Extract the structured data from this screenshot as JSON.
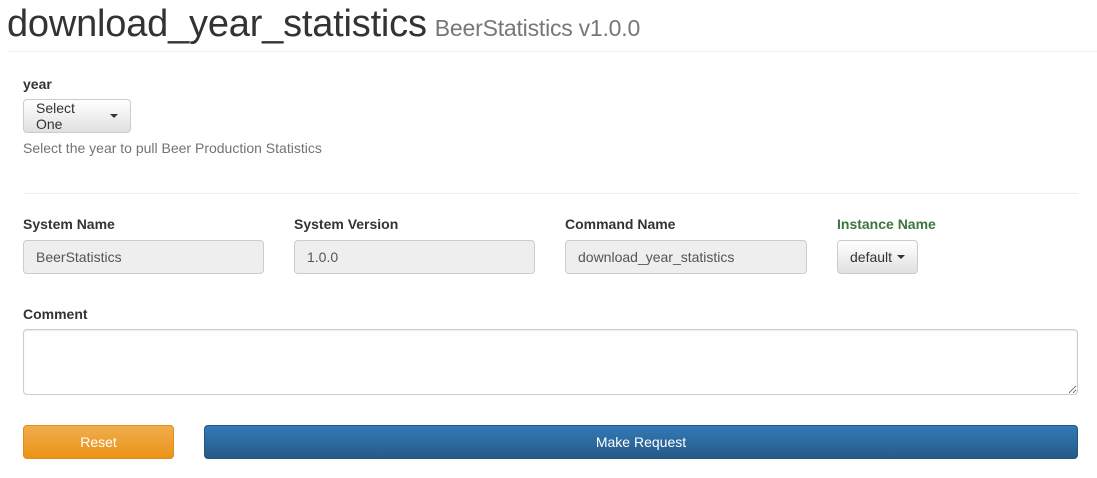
{
  "header": {
    "title": "download_year_statistics",
    "system_name": "BeerStatistics",
    "system_version": "v1.0.0"
  },
  "year_field": {
    "label": "year",
    "selected": "Select One",
    "help": "Select the year to pull Beer Production Statistics"
  },
  "system_info": {
    "system_name_label": "System Name",
    "system_name_value": "BeerStatistics",
    "system_version_label": "System Version",
    "system_version_value": "1.0.0",
    "command_name_label": "Command Name",
    "command_name_value": "download_year_statistics",
    "instance_name_label": "Instance Name",
    "instance_name_selected": "default"
  },
  "comment": {
    "label": "Comment",
    "value": ""
  },
  "buttons": {
    "reset_label": "Reset",
    "make_request_label": "Make Request"
  },
  "colors": {
    "reset": "#f0ad4e",
    "primary": "#337ab7",
    "instance_label": "#3c763d"
  }
}
